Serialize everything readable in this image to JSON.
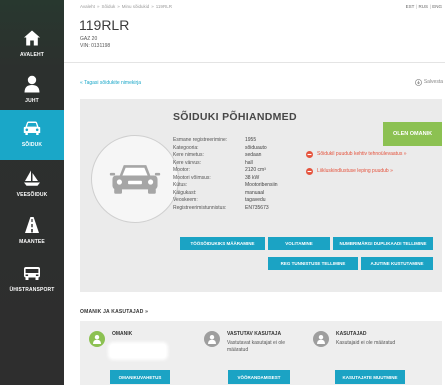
{
  "sidebar": {
    "items": [
      {
        "label": "AVALEHT",
        "icon": "home-icon"
      },
      {
        "label": "JUHT",
        "icon": "person-icon"
      },
      {
        "label": "SÕIDUK",
        "icon": "car-icon",
        "active": true
      },
      {
        "label": "VEESÕIDUK",
        "icon": "sailboat-icon"
      },
      {
        "label": "MAANTEE",
        "icon": "road-icon"
      },
      {
        "label": "ÜHISTRANSPORT",
        "icon": "bus-icon"
      }
    ]
  },
  "breadcrumb": {
    "items": [
      "Avaleht",
      "Sõiduk",
      "Minu sõidukid",
      "119RLR"
    ],
    "separator": "»"
  },
  "languages": {
    "items": [
      "EST",
      "RUS",
      "ENG"
    ],
    "separator": "|"
  },
  "vehicle": {
    "plate": "119RLR",
    "model": "GAZ 20",
    "vin": "VIN: 0131198"
  },
  "toolbar": {
    "back_link": "« Tagasi sõidukite nimekirja",
    "save_link": "Salvesta",
    "save_icon": "download-icon"
  },
  "details_card": {
    "title": "SÕIDUKI PÕHIANDMED",
    "owner_button": "OLEN OMANIK",
    "image_icon": "car-icon",
    "details": [
      {
        "label": "Esmane registreerimine:",
        "value": "1955"
      },
      {
        "label": "Kategooria:",
        "value": "sõiduauto"
      },
      {
        "label": "Kere nimetus:",
        "value": "sedaan"
      },
      {
        "label": "Kere värvus:",
        "value": "hall"
      },
      {
        "label": "Mootor:",
        "value": "2120 cm³"
      },
      {
        "label": "Mootori võimsus:",
        "value": "38 kW"
      },
      {
        "label": "Kütus:",
        "value": "Mootoribensiin"
      },
      {
        "label": "Käigukast:",
        "value": "manuaal"
      },
      {
        "label": "Veoskeem:",
        "value": "tagavedu"
      },
      {
        "label": "Registreerimistunnistus:",
        "value": "EN735673"
      }
    ],
    "alerts": [
      {
        "text": "Sõidukil puudub kehtiv tehnoülevaatus »",
        "icon": "minus-circle-icon"
      },
      {
        "text": "Liikluskindlustuse leping puudub »",
        "icon": "minus-circle-icon"
      }
    ],
    "actions": [
      "TÖÖSÕIDUKIKS MÄÄRAMINE",
      "VOLITAMINE",
      "NUMBRIMÄRGI DUPLIKAADI TELLIMINE",
      "REG TUNNISTUSE TELLIMINE",
      "AJUTINE KUSTUTAMINE"
    ]
  },
  "owners_section": {
    "title": "OMANIK JA KASUTAJAD »",
    "columns": [
      {
        "title": "OMANIK",
        "icon": "person-icon"
      },
      {
        "title": "VASTUTAV KASUTAJA",
        "icon": "person-icon",
        "text": "Vastutavat kasutajat ei ole määratud"
      },
      {
        "title": "KASUTAJAD",
        "icon": "person-icon",
        "text": "Kasutajaid ei ole määratud"
      }
    ],
    "buttons": [
      "OMANIKUVAHETUS",
      "VÕÕRANDAMISEST",
      "KASUTAJATE MUUTMINE"
    ]
  },
  "colors": {
    "sidebar": "#2e2e2e",
    "active_nav": "#1aa7c8",
    "action_button": "#1ba3c4",
    "owner_button": "#8cc152",
    "alert": "#e5533d",
    "link": "#1aa7c8",
    "owner_icon": "#8cc152",
    "user_icon": "#9e9e9e"
  }
}
